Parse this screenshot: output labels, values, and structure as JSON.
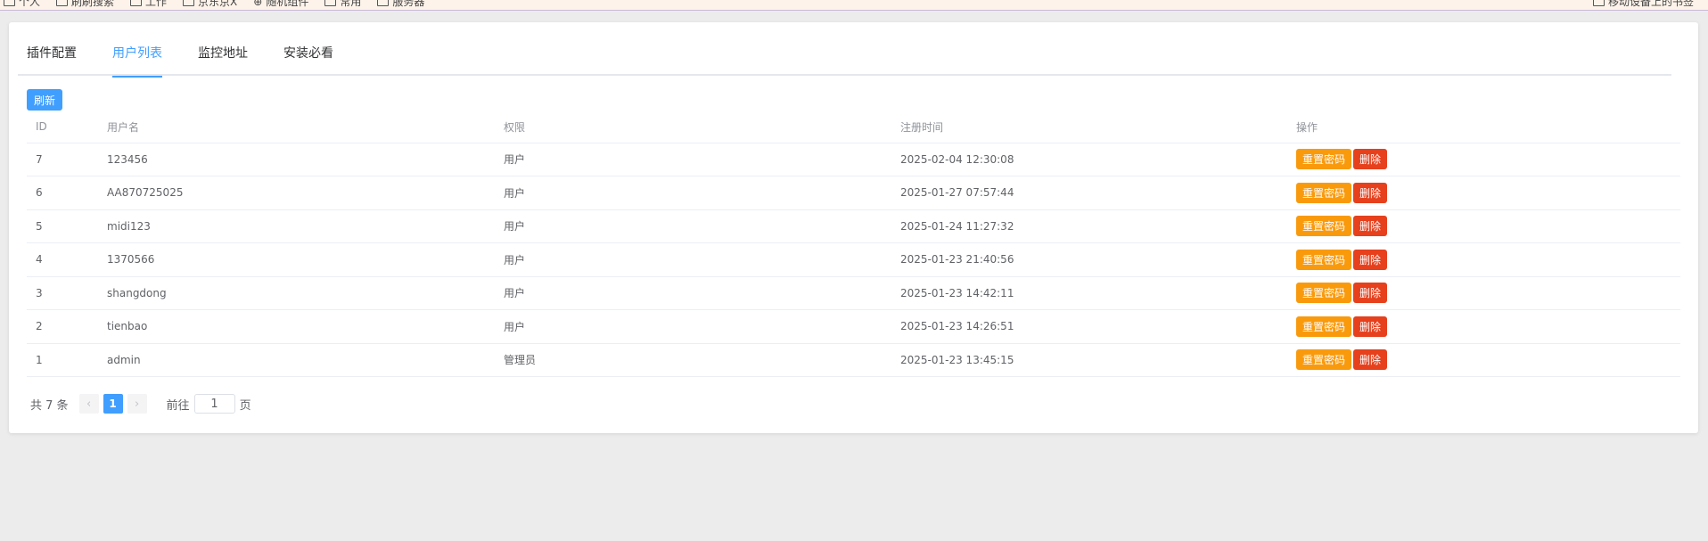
{
  "bookmarks": {
    "items": [
      {
        "label": "个人",
        "icon": "folder-icon"
      },
      {
        "label": "刷刷搜索",
        "icon": "folder-icon"
      },
      {
        "label": "工作",
        "icon": "folder-icon"
      },
      {
        "label": "京东京X",
        "icon": "folder-icon"
      },
      {
        "label": "随机组件",
        "icon": "globe-icon"
      },
      {
        "label": "常用",
        "icon": "folder-icon"
      },
      {
        "label": "服务器",
        "icon": "folder-icon"
      }
    ],
    "right_label": "移动设备上的书签"
  },
  "tabs": [
    {
      "label": "插件配置",
      "active": false
    },
    {
      "label": "用户列表",
      "active": true
    },
    {
      "label": "监控地址",
      "active": false
    },
    {
      "label": "安装必看",
      "active": false
    }
  ],
  "refresh_label": "刷新",
  "table": {
    "headers": [
      "ID",
      "用户名",
      "权限",
      "注册时间",
      "操作"
    ],
    "rows": [
      {
        "id": "7",
        "username": "123456",
        "role": "用户",
        "registered": "2025-02-04 12:30:08"
      },
      {
        "id": "6",
        "username": "AA870725025",
        "role": "用户",
        "registered": "2025-01-27 07:57:44"
      },
      {
        "id": "5",
        "username": "midi123",
        "role": "用户",
        "registered": "2025-01-24 11:27:32"
      },
      {
        "id": "4",
        "username": "1370566",
        "role": "用户",
        "registered": "2025-01-23 21:40:56"
      },
      {
        "id": "3",
        "username": "shangdong",
        "role": "用户",
        "registered": "2025-01-23 14:42:11"
      },
      {
        "id": "2",
        "username": "tienbao",
        "role": "用户",
        "registered": "2025-01-23 14:26:51"
      },
      {
        "id": "1",
        "username": "admin",
        "role": "管理员",
        "registered": "2025-01-23 13:45:15"
      }
    ],
    "reset_label": "重置密码",
    "delete_label": "删除"
  },
  "pagination": {
    "total": "共 7 条",
    "current_page": "1",
    "goto_prefix": "前往",
    "goto_value": "1",
    "goto_suffix": "页"
  },
  "colors": {
    "primary": "#409eff",
    "warning": "#f99a0d",
    "danger": "#e6401d"
  }
}
